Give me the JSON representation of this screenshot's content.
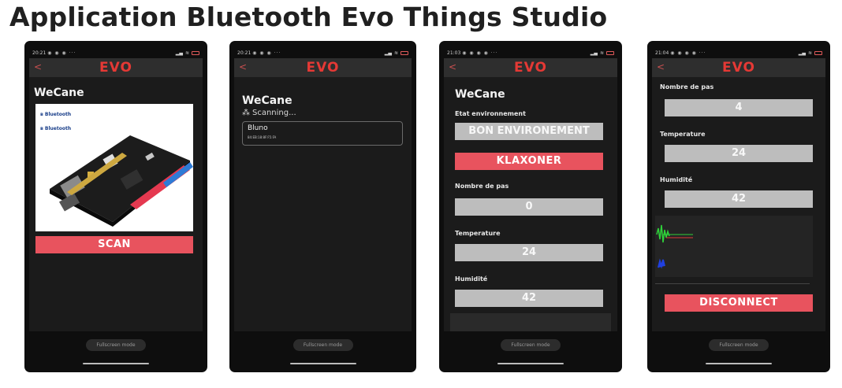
{
  "slide": {
    "title": "Application Bluetooth Evo Things Studio"
  },
  "common": {
    "logo": "EVO",
    "back": "<",
    "fullscreen_label": "Fullscreen mode"
  },
  "colors": {
    "accent": "#e8535e",
    "logo": "#e53935",
    "value_box": "#bdbdbd",
    "background": "#1b1b1b"
  },
  "phones": [
    {
      "status_time": "20:21",
      "app_name": "WeCane",
      "bluetooth_logos": [
        "Bluetooth",
        "Bluetooth"
      ],
      "scan_button": "SCAN"
    },
    {
      "status_time": "20:21",
      "app_name": "WeCane",
      "scanning_text": "Scanning...",
      "device": {
        "name": "Bluno",
        "address": "84:EB:18:8F:F5:FA"
      }
    },
    {
      "status_time": "21:03",
      "app_name": "WeCane",
      "env_label": "Etat environnement",
      "env_value": "BON ENVIRONEMENT",
      "horn_button": "KLAXONER",
      "steps_label": "Nombre de pas",
      "steps_value": "0",
      "temp_label": "Temperature",
      "temp_value": "24",
      "humidity_label": "Humidité",
      "humidity_value": "42"
    },
    {
      "status_time": "21:04",
      "steps_label": "Nombre de pas",
      "steps_value": "4",
      "temp_label": "Temperature",
      "temp_value": "24",
      "humidity_label": "Humidité",
      "humidity_value": "42",
      "disconnect_button": "DISCONNECT"
    }
  ]
}
